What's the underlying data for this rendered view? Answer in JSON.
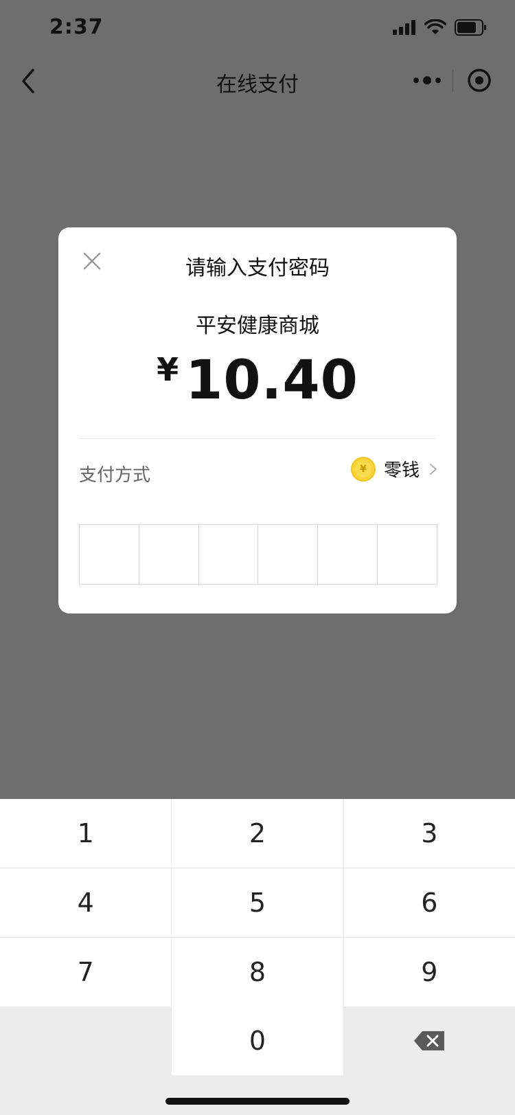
{
  "status": {
    "time": "2:37"
  },
  "nav": {
    "title": "在线支付"
  },
  "dialog": {
    "title": "请输入支付密码",
    "merchant": "平安健康商城",
    "amount": {
      "currency": "¥",
      "value": "10.40"
    },
    "pay_method": {
      "label": "支付方式",
      "value": "零钱"
    },
    "pin_length": 6
  },
  "keypad": {
    "rows": [
      [
        "1",
        "2",
        "3"
      ],
      [
        "4",
        "5",
        "6"
      ],
      [
        "7",
        "8",
        "9"
      ],
      [
        "",
        "0",
        "backspace"
      ]
    ]
  },
  "colors": {
    "overlay": "#6e6e6e",
    "dialog_bg": "#ffffff",
    "coin": "#f7d43a",
    "keypad_bg": "#ececec"
  }
}
